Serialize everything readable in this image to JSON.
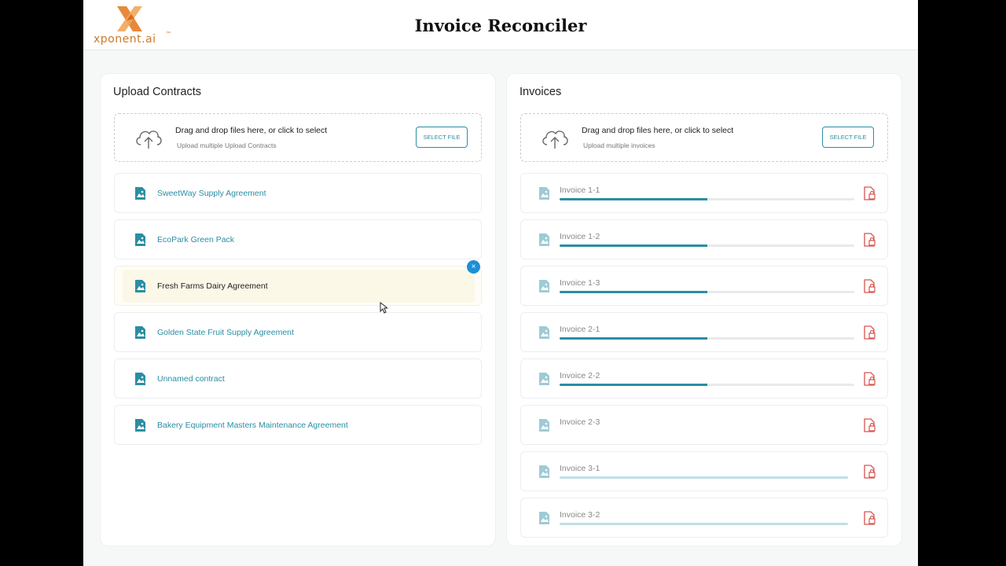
{
  "header": {
    "title": "Invoice Reconciler",
    "logo_text": "xponent.ai",
    "logo_mark": "™"
  },
  "contracts_panel": {
    "title": "Upload Contracts",
    "dropzone": {
      "main_text": "Drag and drop files here, or click to select",
      "sub_text": "Upload multiple Upload Contracts",
      "button_label": "Select File"
    },
    "items": [
      {
        "name": "SweetWay Supply Agreement"
      },
      {
        "name": "EcoPark Green Pack"
      },
      {
        "name": "Fresh Farms Dairy Agreement"
      },
      {
        "name": "Golden State Fruit Supply Agreement"
      },
      {
        "name": "Unnamed contract"
      },
      {
        "name": "Bakery Equipment Masters Maintenance Agreement"
      }
    ],
    "active_index": 2,
    "remove_icon": "×"
  },
  "invoices_panel": {
    "title": "Invoices",
    "dropzone": {
      "main_text": "Drag and drop files here, or click to select",
      "sub_text": "Upload multiple invoices",
      "button_label": "Select File"
    },
    "items": [
      {
        "name": "Invoice 1-1",
        "progress": 0.5
      },
      {
        "name": "Invoice 1-2",
        "progress": 0.5
      },
      {
        "name": "Invoice 1-3",
        "progress": 0.5
      },
      {
        "name": "Invoice 2-1",
        "progress": 0.5
      },
      {
        "name": "Invoice 2-2",
        "progress": 0.5
      },
      {
        "name": "Invoice 2-3",
        "progress": 0
      },
      {
        "name": "Invoice 3-1",
        "progress": 1.0
      },
      {
        "name": "Invoice 3-2",
        "progress": 1.0
      }
    ]
  },
  "colors": {
    "accent": "#2a8ea3",
    "remove_button": "#1d8fd6",
    "file_action": "#d9534f",
    "logo_orange": "#e8893a"
  },
  "icons": {
    "upload": "cloud-upload-icon",
    "document": "document-image-icon",
    "file_action": "file-lock-icon",
    "remove": "close-icon"
  }
}
